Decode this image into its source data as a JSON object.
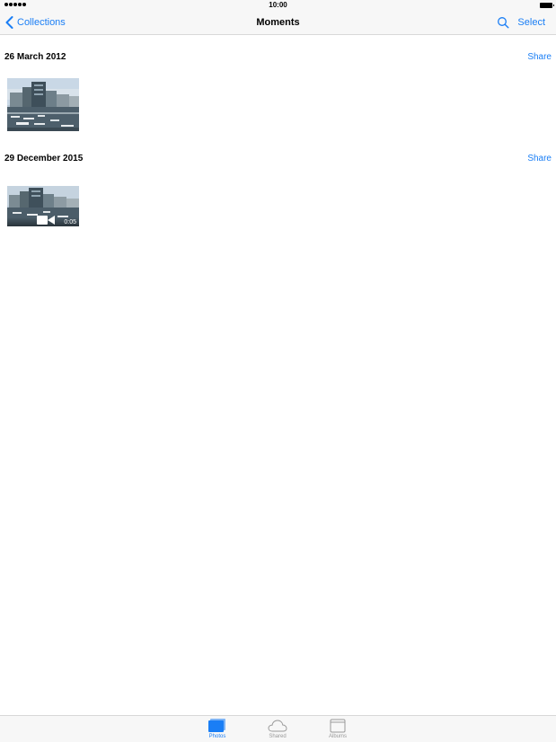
{
  "status_bar": {
    "time": "10:00"
  },
  "nav": {
    "back_label": "Collections",
    "title": "Moments",
    "select_label": "Select"
  },
  "moments": [
    {
      "date": "26 March 2012",
      "share_label": "Share",
      "items": [
        {
          "type": "photo"
        }
      ]
    },
    {
      "date": "29 December 2015",
      "share_label": "Share",
      "items": [
        {
          "type": "video",
          "duration": "0:05"
        }
      ]
    }
  ],
  "tab_bar": {
    "tabs": [
      {
        "label": "Photos",
        "icon": "photos-icon",
        "active": true
      },
      {
        "label": "Shared",
        "icon": "cloud-icon",
        "active": false
      },
      {
        "label": "Albums",
        "icon": "albums-icon",
        "active": false
      }
    ]
  },
  "colors": {
    "accent": "#1a7ef5",
    "bar_background": "#f7f7f7",
    "inactive_tab": "#9a9a9a"
  }
}
